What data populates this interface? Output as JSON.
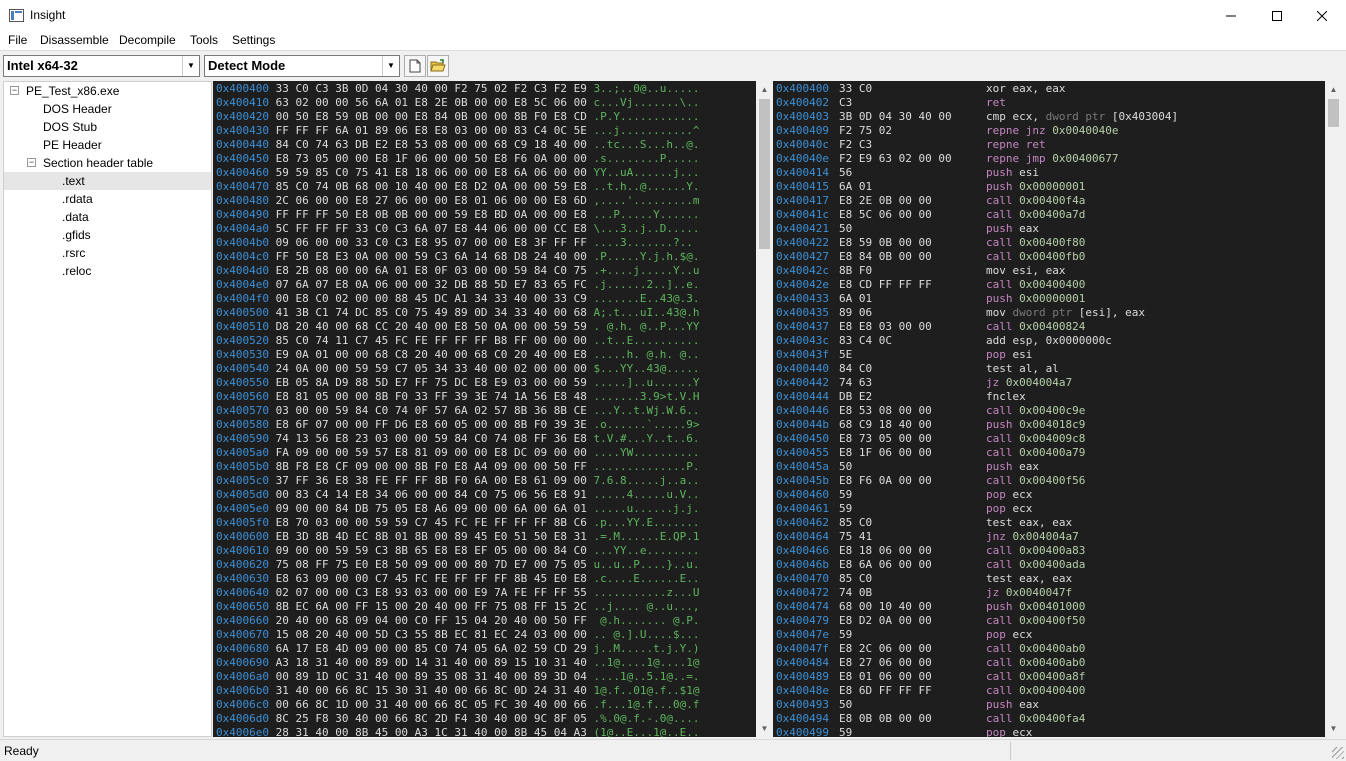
{
  "window": {
    "title": "Insight"
  },
  "menu": [
    "File",
    "Disassemble",
    "Decompile",
    "Tools",
    "Settings"
  ],
  "toolbar": {
    "arch": "Intel x64-32",
    "mode": "Detect Mode"
  },
  "tree": {
    "root": "PE_Test_x86.exe",
    "items": [
      "DOS Header",
      "DOS Stub",
      "PE Header"
    ],
    "section_table": "Section header table",
    "sections": [
      ".text",
      ".rdata",
      ".data",
      ".gfids",
      ".rsrc",
      ".reloc"
    ],
    "selected": ".text"
  },
  "hex_rows": [
    [
      "0x400400",
      "33 C0 C3 3B 0D 04 30 40 00 F2 75 02 F2 C3 F2 E9",
      "3..;..0@..u....."
    ],
    [
      "0x400410",
      "63 02 00 00 56 6A 01 E8 2E 0B 00 00 E8 5C 06 00",
      "c...Vj.......\\.."
    ],
    [
      "0x400420",
      "00 50 E8 59 0B 00 00 E8 84 0B 00 00 8B F0 E8 CD",
      ".P.Y............"
    ],
    [
      "0x400430",
      "FF FF FF 6A 01 89 06 E8 E8 03 00 00 83 C4 0C 5E",
      "...j...........^"
    ],
    [
      "0x400440",
      "84 C0 74 63 DB E2 E8 53 08 00 00 68 C9 18 40 00",
      "..tc...S...h..@."
    ],
    [
      "0x400450",
      "E8 73 05 00 00 E8 1F 06 00 00 50 E8 F6 0A 00 00",
      ".s........P....."
    ],
    [
      "0x400460",
      "59 59 85 C0 75 41 E8 18 06 00 00 E8 6A 06 00 00",
      "YY..uA......j..."
    ],
    [
      "0x400470",
      "85 C0 74 0B 68 00 10 40 00 E8 D2 0A 00 00 59 E8",
      "..t.h..@......Y."
    ],
    [
      "0x400480",
      "2C 06 00 00 E8 27 06 00 00 E8 01 06 00 00 E8 6D",
      ",....'.........m"
    ],
    [
      "0x400490",
      "FF FF FF 50 E8 0B 0B 00 00 59 E8 BD 0A 00 00 E8",
      "...P.....Y......"
    ],
    [
      "0x4004a0",
      "5C FF FF FF 33 C0 C3 6A 07 E8 44 06 00 00 CC E8",
      "\\...3..j..D....."
    ],
    [
      "0x4004b0",
      "09 06 00 00 33 C0 C3 E8 95 07 00 00 E8 3F FF FF",
      "....3.......?.."
    ],
    [
      "0x4004c0",
      "FF 50 E8 E3 0A 00 00 59 C3 6A 14 68 D8 24 40 00",
      ".P.....Y.j.h.$@."
    ],
    [
      "0x4004d0",
      "E8 2B 08 00 00 6A 01 E8 0F 03 00 00 59 84 C0 75",
      ".+....j.....Y..u"
    ],
    [
      "0x4004e0",
      "07 6A 07 E8 0A 06 00 00 32 DB 88 5D E7 83 65 FC",
      ".j......2..]..e."
    ],
    [
      "0x4004f0",
      "00 E8 C0 02 00 00 88 45 DC A1 34 33 40 00 33 C9",
      ".......E..43@.3."
    ],
    [
      "0x400500",
      "41 3B C1 74 DC 85 C0 75 49 89 0D 34 33 40 00 68",
      "A;.t...uI..43@.h"
    ],
    [
      "0x400510",
      "D8 20 40 00 68 CC 20 40 00 E8 50 0A 00 00 59 59",
      ". @.h. @..P...YY"
    ],
    [
      "0x400520",
      "85 C0 74 11 C7 45 FC FE FF FF FF B8 FF 00 00 00",
      "..t..E.........."
    ],
    [
      "0x400530",
      "E9 0A 01 00 00 68 C8 20 40 00 68 C0 20 40 00 E8",
      ".....h. @.h. @.."
    ],
    [
      "0x400540",
      "24 0A 00 00 59 59 C7 05 34 33 40 00 02 00 00 00",
      "$...YY..43@....."
    ],
    [
      "0x400550",
      "EB 05 8A D9 88 5D E7 FF 75 DC E8 E9 03 00 00 59",
      ".....]..u......Y"
    ],
    [
      "0x400560",
      "E8 81 05 00 00 8B F0 33 FF 39 3E 74 1A 56 E8 48",
      ".......3.9>t.V.H"
    ],
    [
      "0x400570",
      "03 00 00 59 84 C0 74 0F 57 6A 02 57 8B 36 8B CE",
      "...Y..t.Wj.W.6.."
    ],
    [
      "0x400580",
      "E8 6F 07 00 00 FF D6 E8 60 05 00 00 8B F0 39 3E",
      ".o......`.....9>"
    ],
    [
      "0x400590",
      "74 13 56 E8 23 03 00 00 59 84 C0 74 08 FF 36 E8",
      "t.V.#...Y..t..6."
    ],
    [
      "0x4005a0",
      "FA 09 00 00 59 57 E8 81 09 00 00 E8 DC 09 00 00",
      "....YW.........."
    ],
    [
      "0x4005b0",
      "8B F8 E8 CF 09 00 00 8B F0 E8 A4 09 00 00 50 FF",
      "..............P."
    ],
    [
      "0x4005c0",
      "37 FF 36 E8 38 FE FF FF 8B F0 6A 00 E8 61 09 00",
      "7.6.8.....j..a.."
    ],
    [
      "0x4005d0",
      "00 83 C4 14 E8 34 06 00 00 84 C0 75 06 56 E8 91",
      ".....4.....u.V.."
    ],
    [
      "0x4005e0",
      "09 00 00 84 DB 75 05 E8 A6 09 00 00 6A 00 6A 01",
      ".....u......j.j."
    ],
    [
      "0x4005f0",
      "E8 70 03 00 00 59 59 C7 45 FC FE FF FF FF 8B C6",
      ".p...YY.E......."
    ],
    [
      "0x400600",
      "EB 3D 8B 4D EC 8B 01 8B 00 89 45 E0 51 50 E8 31",
      ".=.M......E.QP.1"
    ],
    [
      "0x400610",
      "09 00 00 59 59 C3 8B 65 E8 E8 EF 05 00 00 84 C0",
      "...YY..e........"
    ],
    [
      "0x400620",
      "75 08 FF 75 E0 E8 50 09 00 00 80 7D E7 00 75 05",
      "u..u..P....}..u."
    ],
    [
      "0x400630",
      "E8 63 09 00 00 C7 45 FC FE FF FF FF 8B 45 E0 E8",
      ".c....E......E.."
    ],
    [
      "0x400640",
      "02 07 00 00 C3 E8 93 03 00 00 E9 7A FE FF FF 55",
      "...........z...U"
    ],
    [
      "0x400650",
      "8B EC 6A 00 FF 15 00 20 40 00 FF 75 08 FF 15 2C",
      "..j.... @..u...,"
    ],
    [
      "0x400660",
      "20 40 00 68 09 04 00 C0 FF 15 04 20 40 00 50 FF",
      " @.h....... @.P."
    ],
    [
      "0x400670",
      "15 08 20 40 00 5D C3 55 8B EC 81 EC 24 03 00 00",
      ".. @.].U....$..."
    ],
    [
      "0x400680",
      "6A 17 E8 4D 09 00 00 85 C0 74 05 6A 02 59 CD 29",
      "j..M.....t.j.Y.)"
    ],
    [
      "0x400690",
      "A3 18 31 40 00 89 0D 14 31 40 00 89 15 10 31 40",
      "..1@....1@....1@"
    ],
    [
      "0x4006a0",
      "00 89 1D 0C 31 40 00 89 35 08 31 40 00 89 3D 04",
      "....1@..5.1@..=."
    ],
    [
      "0x4006b0",
      "31 40 00 66 8C 15 30 31 40 00 66 8C 0D 24 31 40",
      "1@.f..01@.f..$1@"
    ],
    [
      "0x4006c0",
      "00 66 8C 1D 00 31 40 00 66 8C 05 FC 30 40 00 66",
      ".f...1@.f...0@.f"
    ],
    [
      "0x4006d0",
      "8C 25 F8 30 40 00 66 8C 2D F4 30 40 00 9C 8F 05",
      ".%.0@.f.-.0@...."
    ],
    [
      "0x4006e0",
      "28 31 40 00 8B 45 00 A3 1C 31 40 00 8B 45 04 A3",
      "(1@..E...1@..E.."
    ]
  ],
  "dis_rows": [
    [
      "0x400400",
      "33 C0",
      "xor",
      "n",
      "eax, eax",
      ""
    ],
    [
      "0x400402",
      "C3",
      "ret",
      "c",
      "",
      ""
    ],
    [
      "0x400403",
      "3B 0D 04 30 40 00",
      "cmp",
      "n",
      "ecx, ",
      "dword ptr|[0x403004]"
    ],
    [
      "0x400409",
      "F2 75 02",
      "repne jnz",
      "r",
      "0x0040040e",
      ""
    ],
    [
      "0x40040c",
      "F2 C3",
      "repne ret",
      "r",
      "",
      ""
    ],
    [
      "0x40040e",
      "F2 E9 63 02 00 00",
      "repne jmp",
      "r",
      "0x00400677",
      ""
    ],
    [
      "0x400414",
      "56",
      "push",
      "c",
      "esi",
      ""
    ],
    [
      "0x400415",
      "6A 01",
      "push",
      "c",
      "0x00000001",
      "op"
    ],
    [
      "0x400417",
      "E8 2E 0B 00 00",
      "call",
      "c",
      "0x00400f4a",
      "op"
    ],
    [
      "0x40041c",
      "E8 5C 06 00 00",
      "call",
      "c",
      "0x00400a7d",
      "op"
    ],
    [
      "0x400421",
      "50",
      "push",
      "c",
      "eax",
      ""
    ],
    [
      "0x400422",
      "E8 59 0B 00 00",
      "call",
      "c",
      "0x00400f80",
      "op"
    ],
    [
      "0x400427",
      "E8 84 0B 00 00",
      "call",
      "c",
      "0x00400fb0",
      "op"
    ],
    [
      "0x40042c",
      "8B F0",
      "mov",
      "n",
      "esi, eax",
      ""
    ],
    [
      "0x40042e",
      "E8 CD FF FF FF",
      "call",
      "c",
      "0x00400400",
      "op"
    ],
    [
      "0x400433",
      "6A 01",
      "push",
      "c",
      "0x00000001",
      "op"
    ],
    [
      "0x400435",
      "89 06",
      "mov",
      "n",
      " [esi], eax",
      "dword ptr"
    ],
    [
      "0x400437",
      "E8 E8 03 00 00",
      "call",
      "c",
      "0x00400824",
      "op"
    ],
    [
      "0x40043c",
      "83 C4 0C",
      "add",
      "n",
      "esp, 0x0000000c",
      ""
    ],
    [
      "0x40043f",
      "5E",
      "pop",
      "c",
      "esi",
      ""
    ],
    [
      "0x400440",
      "84 C0",
      "test",
      "n",
      "al, al",
      ""
    ],
    [
      "0x400442",
      "74 63",
      "jz",
      "c",
      "0x004004a7",
      "op"
    ],
    [
      "0x400444",
      "DB E2",
      "fnclex",
      "n",
      "",
      ""
    ],
    [
      "0x400446",
      "E8 53 08 00 00",
      "call",
      "c",
      "0x00400c9e",
      "op"
    ],
    [
      "0x40044b",
      "68 C9 18 40 00",
      "push",
      "c",
      "0x004018c9",
      "op"
    ],
    [
      "0x400450",
      "E8 73 05 00 00",
      "call",
      "c",
      "0x004009c8",
      "op"
    ],
    [
      "0x400455",
      "E8 1F 06 00 00",
      "call",
      "c",
      "0x00400a79",
      "op"
    ],
    [
      "0x40045a",
      "50",
      "push",
      "c",
      "eax",
      ""
    ],
    [
      "0x40045b",
      "E8 F6 0A 00 00",
      "call",
      "c",
      "0x00400f56",
      "op"
    ],
    [
      "0x400460",
      "59",
      "pop",
      "c",
      "ecx",
      ""
    ],
    [
      "0x400461",
      "59",
      "pop",
      "c",
      "ecx",
      ""
    ],
    [
      "0x400462",
      "85 C0",
      "test",
      "n",
      "eax, eax",
      ""
    ],
    [
      "0x400464",
      "75 41",
      "jnz",
      "c",
      "0x004004a7",
      "op"
    ],
    [
      "0x400466",
      "E8 18 06 00 00",
      "call",
      "c",
      "0x00400a83",
      "op"
    ],
    [
      "0x40046b",
      "E8 6A 06 00 00",
      "call",
      "c",
      "0x00400ada",
      "op"
    ],
    [
      "0x400470",
      "85 C0",
      "test",
      "n",
      "eax, eax",
      ""
    ],
    [
      "0x400472",
      "74 0B",
      "jz",
      "c",
      "0x0040047f",
      "op"
    ],
    [
      "0x400474",
      "68 00 10 40 00",
      "push",
      "c",
      "0x00401000",
      "op"
    ],
    [
      "0x400479",
      "E8 D2 0A 00 00",
      "call",
      "c",
      "0x00400f50",
      "op"
    ],
    [
      "0x40047e",
      "59",
      "pop",
      "c",
      "ecx",
      ""
    ],
    [
      "0x40047f",
      "E8 2C 06 00 00",
      "call",
      "c",
      "0x00400ab0",
      "op"
    ],
    [
      "0x400484",
      "E8 27 06 00 00",
      "call",
      "c",
      "0x00400ab0",
      "op"
    ],
    [
      "0x400489",
      "E8 01 06 00 00",
      "call",
      "c",
      "0x00400a8f",
      "op"
    ],
    [
      "0x40048e",
      "E8 6D FF FF FF",
      "call",
      "c",
      "0x00400400",
      "op"
    ],
    [
      "0x400493",
      "50",
      "push",
      "c",
      "eax",
      ""
    ],
    [
      "0x400494",
      "E8 0B 0B 00 00",
      "call",
      "c",
      "0x00400fa4",
      "op"
    ],
    [
      "0x400499",
      "59",
      "pop",
      "c",
      "ecx",
      ""
    ]
  ],
  "status": {
    "text": "Ready"
  }
}
